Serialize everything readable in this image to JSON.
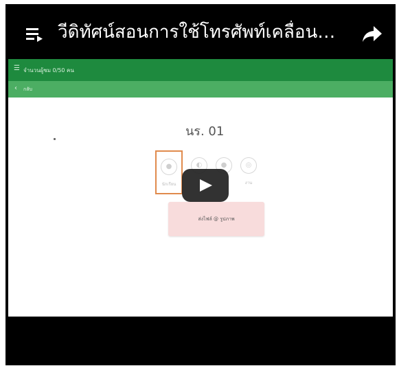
{
  "video": {
    "title": "วีดิทัศน์สอนการใช้โทรศัพท์เคลื่อนที่...",
    "icons": {
      "playlist": "playlist-icon",
      "share": "share-icon",
      "play": "play-icon"
    }
  },
  "app": {
    "appbar_text": "จำนวนผู้ชม 0/50 คน",
    "subbar_text": "กลับ",
    "slide_title": "นร. 01",
    "options": [
      {
        "label": "นักเรียน",
        "selected": true
      },
      {
        "label": "",
        "selected": false
      },
      {
        "label": "",
        "selected": false
      },
      {
        "label": "งาน",
        "selected": false
      }
    ],
    "popup_text": "ส่งไฟล์ @ รูปภาพ"
  },
  "colors": {
    "appbar": "#1e8a3e",
    "subbar": "#4cae63",
    "selected_border": "#e08a4c",
    "popup": "#f8dcdc"
  }
}
